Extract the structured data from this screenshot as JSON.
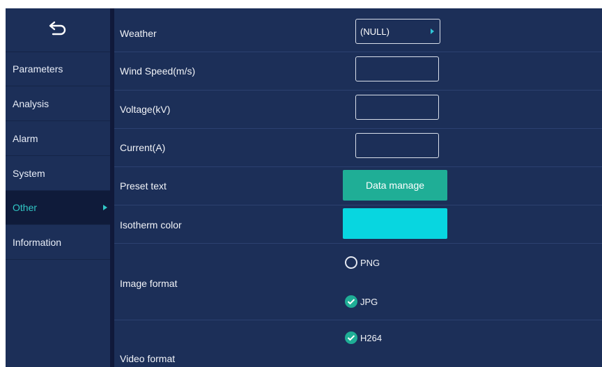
{
  "sidebar": {
    "back_icon": "back-arrow-icon",
    "items": [
      {
        "label": "Parameters",
        "active": false
      },
      {
        "label": "Analysis",
        "active": false
      },
      {
        "label": "Alarm",
        "active": false
      },
      {
        "label": "System",
        "active": false
      },
      {
        "label": "Other",
        "active": true
      },
      {
        "label": "Information",
        "active": false
      }
    ]
  },
  "settings": {
    "weather": {
      "label": "Weather",
      "value": "(NULL)"
    },
    "wind_speed": {
      "label": "Wind Speed(m/s)",
      "value": ""
    },
    "voltage": {
      "label": "Voltage(kV)",
      "value": ""
    },
    "current": {
      "label": "Current(A)",
      "value": ""
    },
    "preset_text": {
      "label": "Preset text",
      "button": "Data manage"
    },
    "isotherm_color": {
      "label": "Isotherm color",
      "color": "#08d6e0"
    },
    "image_format": {
      "label": "Image format",
      "options": [
        {
          "label": "PNG",
          "selected": false
        },
        {
          "label": "JPG",
          "selected": true
        }
      ]
    },
    "video_format": {
      "label": "Video format",
      "options": [
        {
          "label": "H264",
          "selected": true
        }
      ]
    }
  },
  "colors": {
    "background": "#1c2f58",
    "accent": "#31c8c6",
    "button": "#1fae96"
  }
}
